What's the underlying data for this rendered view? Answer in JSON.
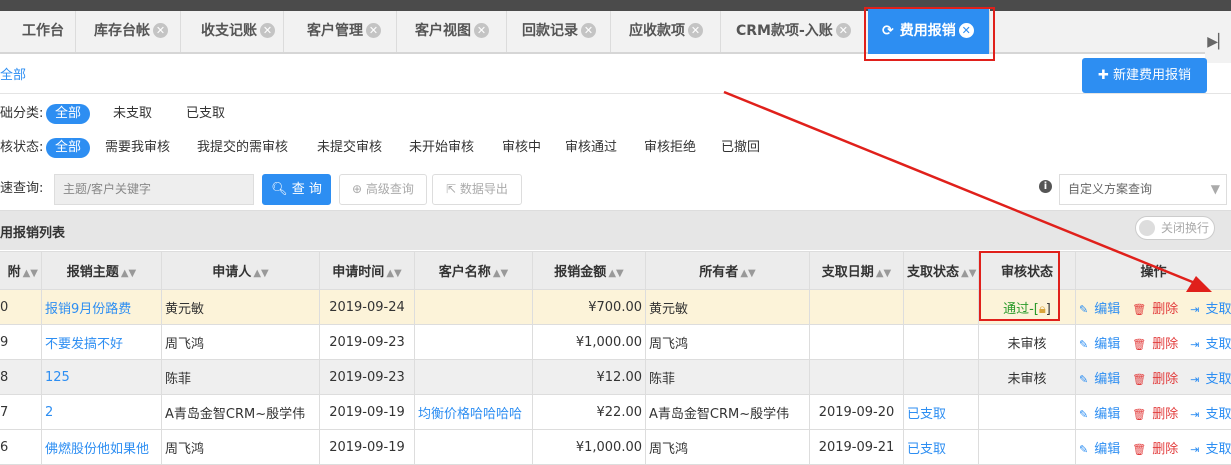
{
  "tabs": [
    {
      "label": "工作台"
    },
    {
      "label": "库存台帐"
    },
    {
      "label": "收支记账"
    },
    {
      "label": "客户管理"
    },
    {
      "label": "客户视图"
    },
    {
      "label": "回款记录"
    },
    {
      "label": "应收款项"
    },
    {
      "label": "CRM款项-入账"
    },
    {
      "label": "费用报销"
    }
  ],
  "subtab": "全部",
  "new_button": "新建费用报销",
  "filters": {
    "category_label": "础分类:",
    "category_options": [
      "全部",
      "未支取",
      "已支取"
    ],
    "status_label": "核状态:",
    "status_options": [
      "全部",
      "需要我审核",
      "我提交的需审核",
      "未提交审核",
      "未开始审核",
      "审核中",
      "审核通过",
      "审核拒绝",
      "已撤回"
    ]
  },
  "search": {
    "label": "速查询:",
    "placeholder": "主题/客户关键字",
    "query_button": "查 询",
    "advanced_button": "高级查询",
    "export_button": "数据导出",
    "plan_placeholder": "自定义方案查询"
  },
  "list": {
    "title": "用报销列表",
    "wrap_toggle": "关闭换行",
    "columns": [
      "附",
      "报销主题",
      "申请人",
      "申请时间",
      "客户名称",
      "报销金额",
      "所有者",
      "支取日期",
      "支取状态",
      "审核状态",
      "操作"
    ],
    "rows": [
      {
        "no": "0",
        "subject": "报销9月份路费",
        "applicant": "黄元敏",
        "date": "2019-09-24",
        "customer": "",
        "amount": "¥700.00",
        "owner": "黄元敏",
        "pay_date": "",
        "pay_status": "",
        "audit": "通过-[",
        "audit_end": "]"
      },
      {
        "no": "9",
        "subject": "不要发搞不好",
        "applicant": "周飞鸿",
        "date": "2019-09-23",
        "customer": "",
        "amount": "¥1,000.00",
        "owner": "周飞鸿",
        "pay_date": "",
        "pay_status": "",
        "audit": "未审核",
        "audit_end": ""
      },
      {
        "no": "8",
        "subject": "125",
        "applicant": "陈菲",
        "date": "2019-09-23",
        "customer": "",
        "amount": "¥12.00",
        "owner": "陈菲",
        "pay_date": "",
        "pay_status": "",
        "audit": "未审核",
        "audit_end": ""
      },
      {
        "no": "7",
        "subject": "2",
        "applicant": "A青岛金智CRM~殷学伟",
        "date": "2019-09-19",
        "customer": "均衡价格哈哈哈哈",
        "amount": "¥22.00",
        "owner": "A青岛金智CRM~殷学伟",
        "pay_date": "2019-09-20",
        "pay_status": "已支取",
        "audit": "",
        "audit_end": ""
      },
      {
        "no": "6",
        "subject": "佛燃股份他如果他",
        "applicant": "周飞鸿",
        "date": "2019-09-19",
        "customer": "",
        "amount": "¥1,000.00",
        "owner": "周飞鸿",
        "pay_date": "2019-09-21",
        "pay_status": "已支取",
        "audit": "",
        "audit_end": ""
      }
    ],
    "actions": {
      "edit": "编辑",
      "delete": "删除",
      "withdraw": "支取"
    }
  },
  "colors": {
    "accent": "#2d8ef2",
    "annotation": "#e0201b",
    "highlight_row": "#fcf3d9"
  }
}
